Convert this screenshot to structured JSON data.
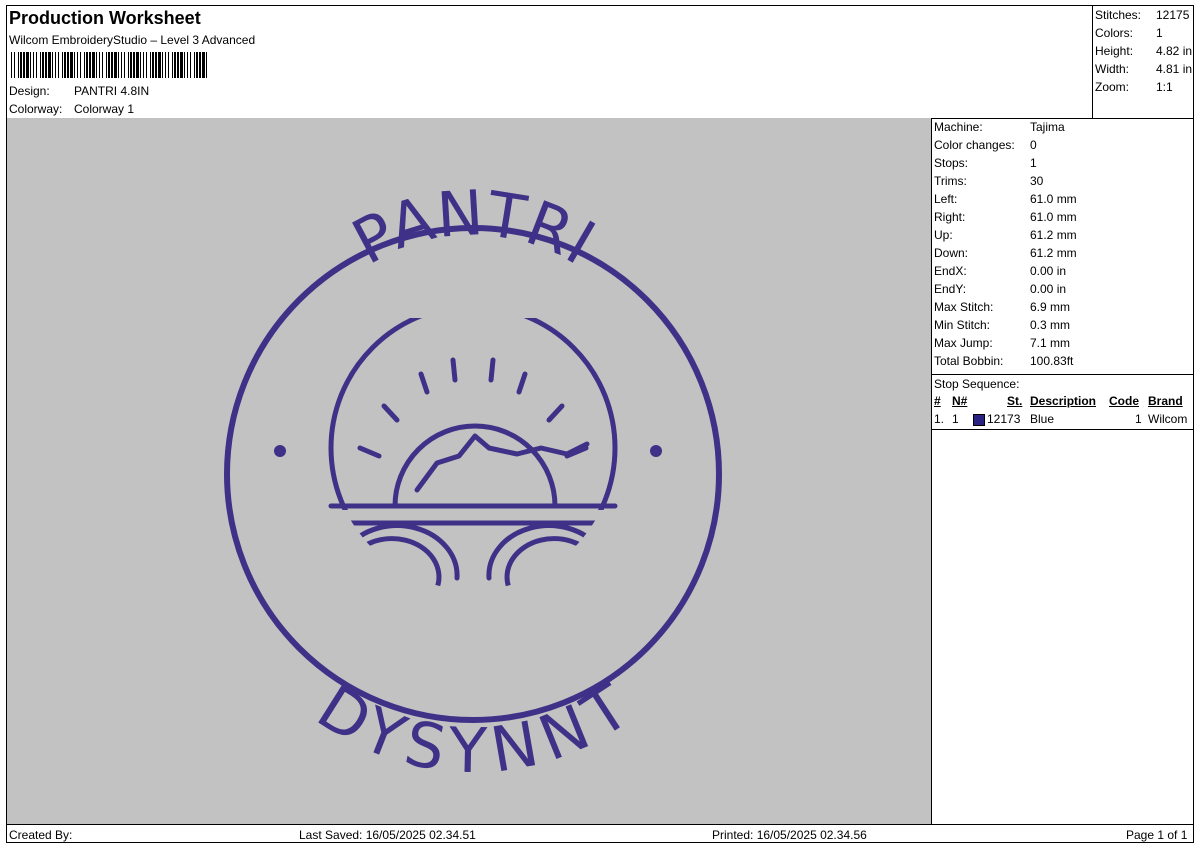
{
  "header": {
    "title": "Production Worksheet",
    "subtitle": "Wilcom EmbroideryStudio – Level 3 Advanced",
    "design_label": "Design:",
    "design_value": "PANTRI 4.8IN",
    "colorway_label": "Colorway:",
    "colorway_value": "Colorway 1"
  },
  "summary": [
    {
      "label": "Stitches:",
      "value": "12175"
    },
    {
      "label": "Colors:",
      "value": "1"
    },
    {
      "label": "Height:",
      "value": "4.82 in"
    },
    {
      "label": "Width:",
      "value": "4.81 in"
    },
    {
      "label": "Zoom:",
      "value": "1:1"
    }
  ],
  "specs": [
    {
      "label": "Machine:",
      "value": "Tajima"
    },
    {
      "label": "Color changes:",
      "value": "0"
    },
    {
      "label": "Stops:",
      "value": "1"
    },
    {
      "label": "Trims:",
      "value": "30"
    },
    {
      "label": "Left:",
      "value": "61.0 mm"
    },
    {
      "label": "Right:",
      "value": "61.0 mm"
    },
    {
      "label": "Up:",
      "value": "61.2 mm"
    },
    {
      "label": "Down:",
      "value": "61.2 mm"
    },
    {
      "label": "EndX:",
      "value": "0.00 in"
    },
    {
      "label": "EndY:",
      "value": "0.00 in"
    },
    {
      "label": "Max Stitch:",
      "value": "6.9 mm"
    },
    {
      "label": "Min Stitch:",
      "value": "0.3 mm"
    },
    {
      "label": "Max Jump:",
      "value": "7.1 mm"
    },
    {
      "label": "Total Bobbin:",
      "value": "100.83ft"
    }
  ],
  "stop_sequence": {
    "title": "Stop Sequence:",
    "columns": [
      "#",
      "N#",
      "St.",
      "Description",
      "Code",
      "Brand"
    ],
    "rows": [
      {
        "num": "1.",
        "n": "1",
        "stitches": "12173",
        "description": "Blue",
        "code": "1",
        "brand": "Wilcom",
        "color": "#2a2280"
      }
    ]
  },
  "design": {
    "thread_color": "#3f3187",
    "background_color": "#c2c2c2",
    "top_text": "PANTRI",
    "bottom_text": "DYSYNNT"
  },
  "footer": {
    "created_by": "Created By:",
    "last_saved": "Last Saved: 16/05/2025 02.34.51",
    "printed": "Printed: 16/05/2025 02.34.56",
    "page": "Page 1 of 1"
  }
}
